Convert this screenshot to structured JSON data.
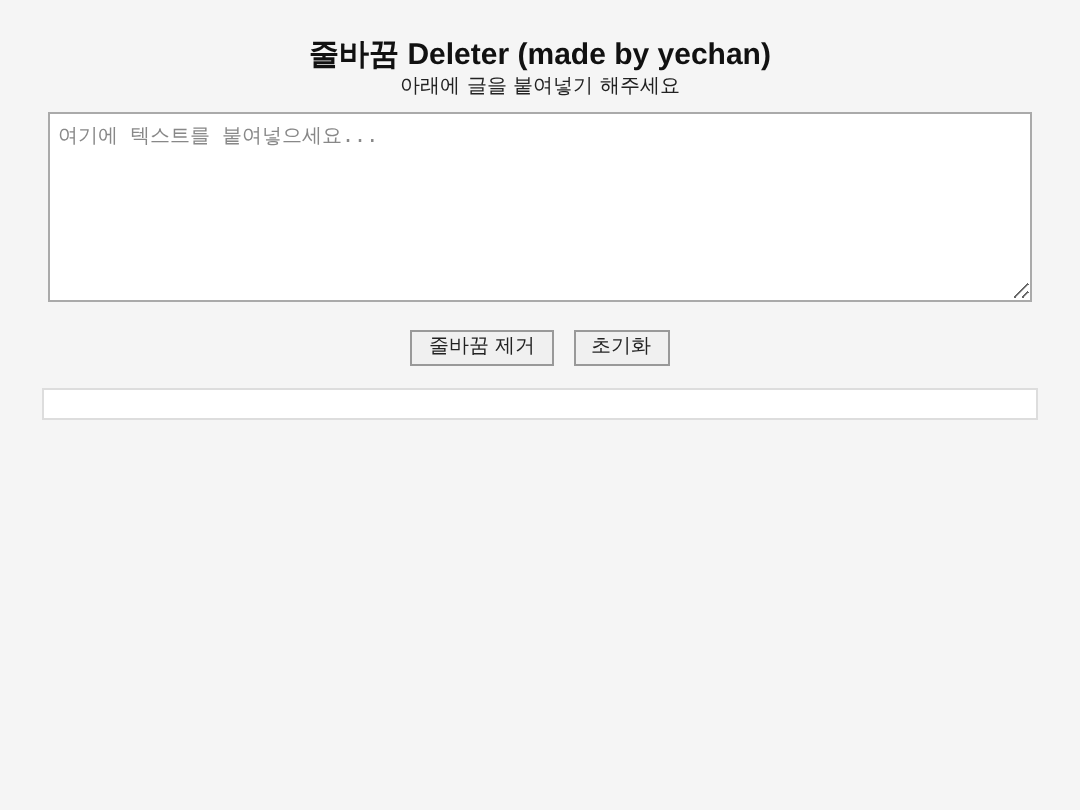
{
  "title": "줄바꿈 Deleter (made by yechan)",
  "subtitle": "아래에 글을 붙여넣기 해주세요",
  "input": {
    "placeholder": "여기에 텍스트를 붙여넣으세요..."
  },
  "buttons": [
    {
      "label": "줄바꿈 제거"
    },
    {
      "label": "초기화"
    }
  ]
}
